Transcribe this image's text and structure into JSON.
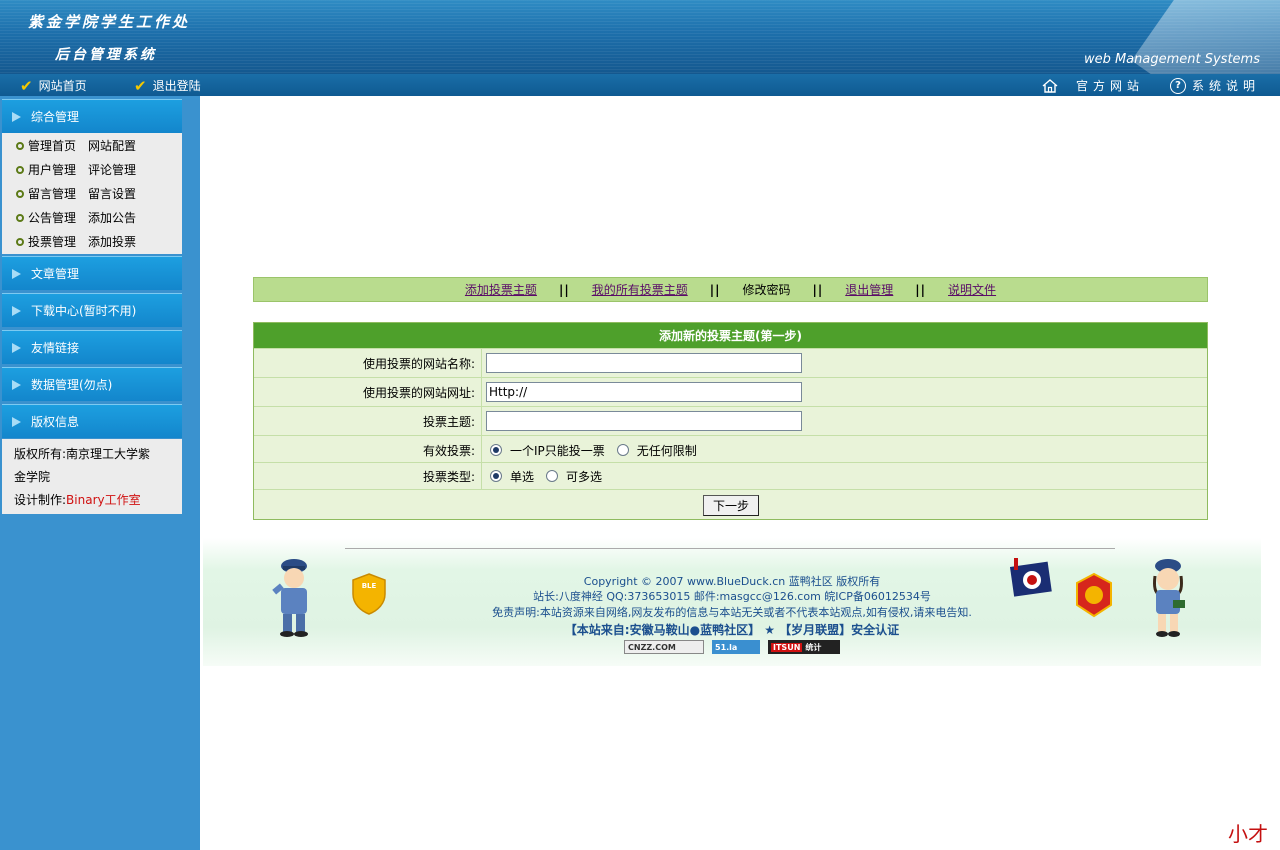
{
  "header": {
    "title_line1": "紫金学院学生工作处",
    "title_line2": "后台管理系统",
    "subtitle": "web Management Systems"
  },
  "topnav": {
    "left_items": [
      {
        "label": "网站首页",
        "icon": "check-icon"
      },
      {
        "label": "退出登陆",
        "icon": "check-icon"
      }
    ],
    "right_items": [
      {
        "label": "官方网站",
        "icon": "home-icon"
      },
      {
        "label": "系统说明",
        "icon": "help-icon"
      }
    ]
  },
  "sidebar": {
    "sections": [
      {
        "label": "综合管理"
      },
      {
        "label": "文章管理"
      },
      {
        "label": "下载中心(暂时不用)"
      },
      {
        "label": "友情链接"
      },
      {
        "label": "数据管理(勿点)"
      },
      {
        "label": "版权信息"
      }
    ],
    "menu": [
      {
        "a": "管理首页",
        "b": "网站配置"
      },
      {
        "a": "用户管理",
        "b": "评论管理"
      },
      {
        "a": "留言管理",
        "b": "留言设置"
      },
      {
        "a": "公告管理",
        "b": "添加公告"
      },
      {
        "a": "投票管理",
        "b": "添加投票"
      }
    ],
    "copyright": {
      "line1": "版权所有:南京理工大学紫",
      "line2": "金学院",
      "designer_label": "设计制作:",
      "designer": "Binary工作室"
    }
  },
  "linkbar": {
    "links": [
      "添加投票主题",
      "我的所有投票主题",
      "修改密码",
      "退出管理",
      "说明文件"
    ],
    "separator": "||"
  },
  "form": {
    "title": "添加新的投票主题(第一步)",
    "fields": [
      {
        "label": "使用投票的网站名称:",
        "value": ""
      },
      {
        "label": "使用投票的网站网址:",
        "value": "Http://"
      },
      {
        "label": "投票主题:",
        "value": ""
      }
    ],
    "valid_vote": {
      "label": "有效投票:",
      "options": [
        "一个IP只能投一票",
        "无任何限制"
      ],
      "selected": 0
    },
    "vote_type": {
      "label": "投票类型:",
      "options": [
        "单选",
        "可多选"
      ],
      "selected": 0
    },
    "next_button": "下一步"
  },
  "footer": {
    "copyright": "Copyright © 2007 www.BlueDuck.cn 蓝鸭社区 版权所有",
    "webmaster": "站长:八度神经 QQ:373653015 邮件:masgcc@126.com 皖ICP备06012534号",
    "disclaimer": "免责声明:本站资源来自网络,网友发布的信息与本站无关或者不代表本站观点,如有侵权,请来电告知.",
    "cert": "【本站来自:安徽马鞍山●蓝鸭社区】 ★ 【岁月联盟】安全认证",
    "badges": [
      "CNZZ.COM",
      "51.la",
      "ITSUN",
      "统计"
    ],
    "badge_left": "BLE"
  },
  "corner_text": "小才"
}
